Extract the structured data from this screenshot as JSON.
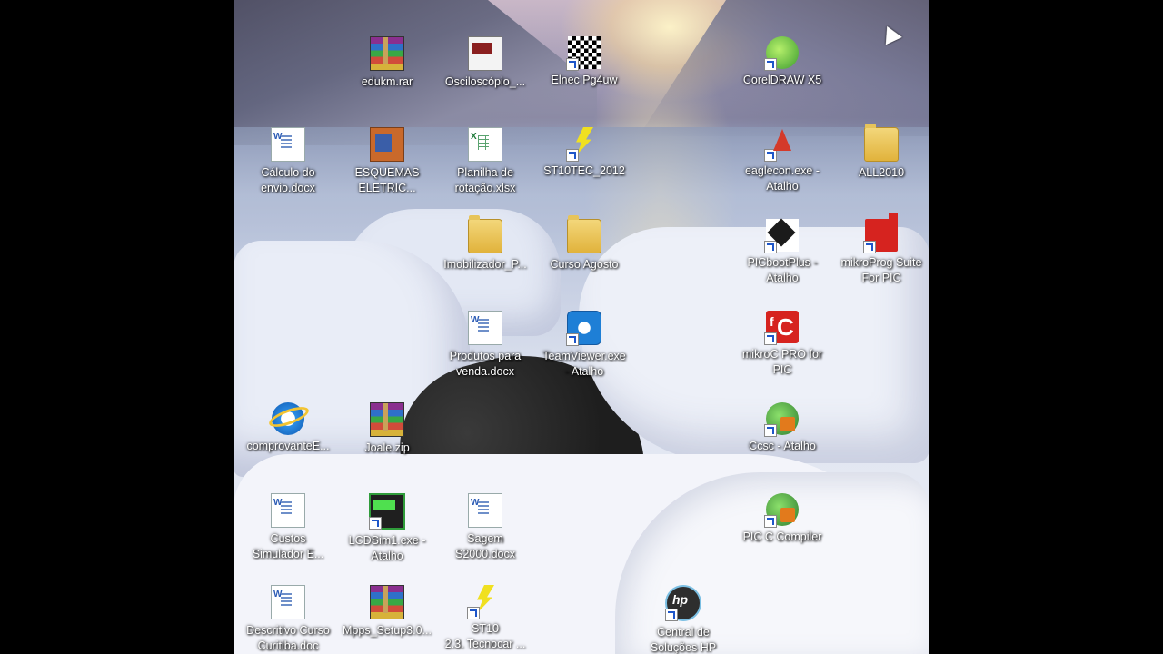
{
  "desktop": {
    "icons": [
      {
        "label": "edukm.rar",
        "icon": "winrar-archive-icon"
      },
      {
        "label": "Osciloscópio_...",
        "icon": "document-image-icon"
      },
      {
        "label": "Elnec Pg4uw",
        "icon": "elnec-icon"
      },
      {
        "label": "CorelDRAW X5",
        "icon": "coreldraw-icon"
      },
      {
        "label": "Cálculo do\nenvio.docx",
        "icon": "word-document-icon"
      },
      {
        "label": "ESQUEMAS\nELETRIC...",
        "icon": "book-icon"
      },
      {
        "label": "Planilha de\nrotação.xlsx",
        "icon": "excel-document-icon"
      },
      {
        "label": "ST10TEC_2012",
        "icon": "lightning-icon"
      },
      {
        "label": "eaglecon.exe -\nAtalho",
        "icon": "eagle-icon"
      },
      {
        "label": "ALL2010",
        "icon": "folder-icon"
      },
      {
        "label": "Imobilizador_P...",
        "icon": "folder-icon"
      },
      {
        "label": "Curso Agosto",
        "icon": "folder-icon"
      },
      {
        "label": "PICbootPlus -\nAtalho",
        "icon": "picboot-icon"
      },
      {
        "label": "mikroProg Suite\nFor PIC",
        "icon": "mikroprog-icon"
      },
      {
        "label": "Produtos para\nvenda.docx",
        "icon": "word-document-icon"
      },
      {
        "label": "TeamViewer.exe\n- Atalho",
        "icon": "teamviewer-icon"
      },
      {
        "label": "mikroC PRO for\nPIC",
        "icon": "mikroc-icon"
      },
      {
        "label": "comprovanteE...",
        "icon": "internet-explorer-icon"
      },
      {
        "label": "Joale.zip",
        "icon": "winrar-archive-icon"
      },
      {
        "label": "Ccsc - Atalho",
        "icon": "ccs-icon"
      },
      {
        "label": "Custos\nSimulador E...",
        "icon": "word-document-icon"
      },
      {
        "label": "LCDSim1.exe -\nAtalho",
        "icon": "lcd-icon"
      },
      {
        "label": "Sagem\nS2000.docx",
        "icon": "word-document-icon"
      },
      {
        "label": "PIC C Compiler",
        "icon": "ccs-icon"
      },
      {
        "label": "Descritivo Curso\nCuritiba.doc",
        "icon": "word-document-icon"
      },
      {
        "label": "Mpps_Setup3.0...",
        "icon": "winrar-archive-icon"
      },
      {
        "label": "ST10\n2.3. Tecnocar ...",
        "icon": "lightning-icon"
      },
      {
        "label": "Central de\nSoluções HP",
        "icon": "hp-icon"
      }
    ]
  }
}
